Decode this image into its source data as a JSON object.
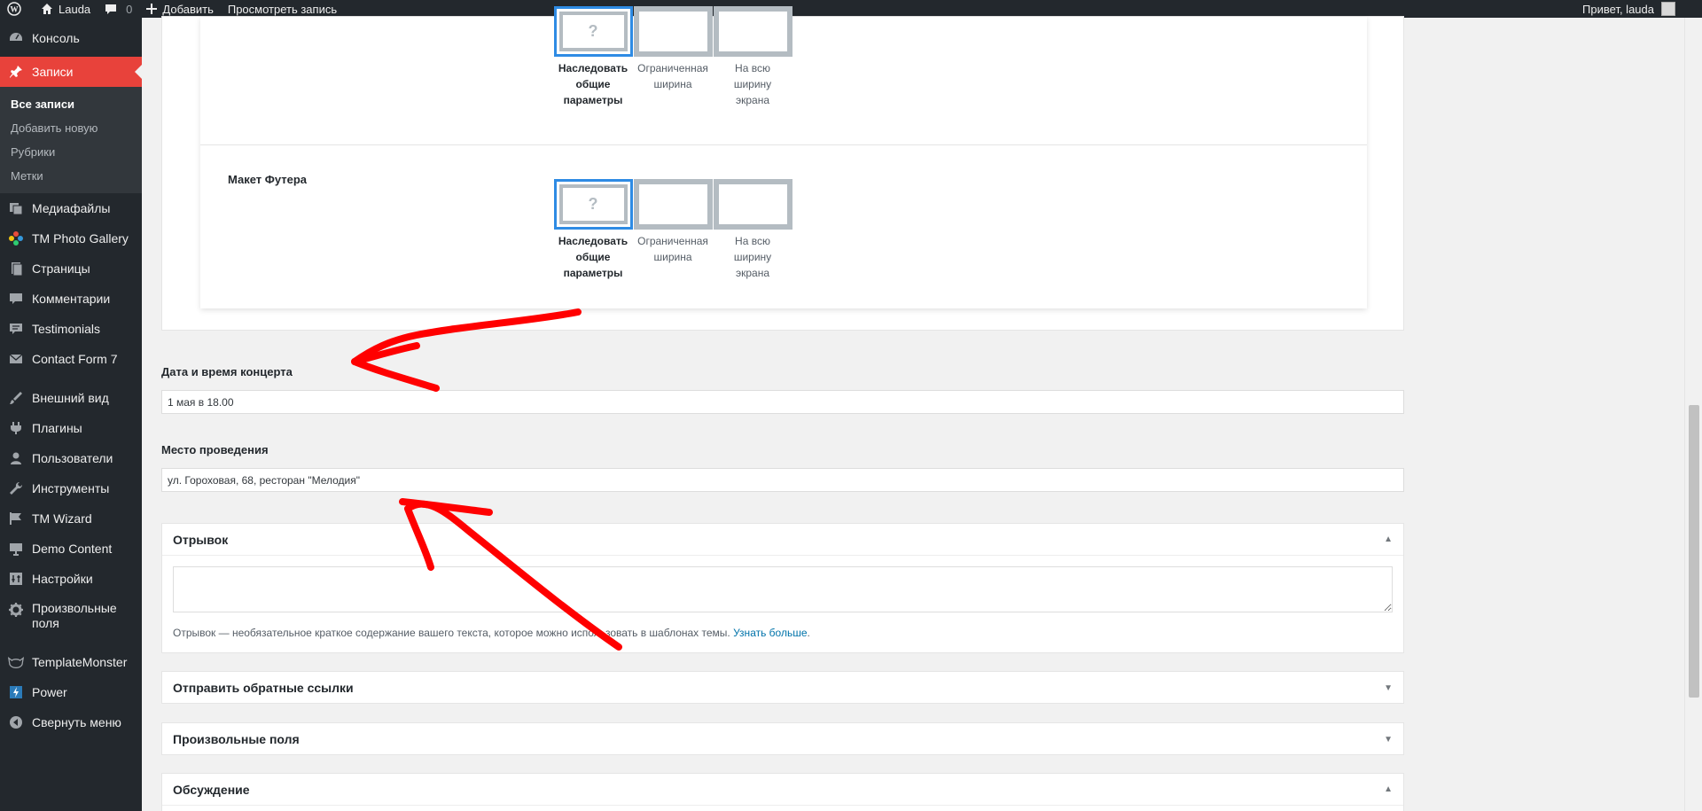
{
  "admin_bar": {
    "site_name": "Lauda",
    "comments_count": "0",
    "add_label": "Добавить",
    "view_label": "Просмотреть запись",
    "greeting": "Привет, lauda"
  },
  "sidebar": {
    "items": [
      {
        "label": "Консоль",
        "icon": "dashboard-icon"
      },
      {
        "label": "Записи",
        "icon": "pin-icon"
      },
      {
        "label": "Медиафайлы",
        "icon": "media-icon"
      },
      {
        "label": "TM Photo Gallery",
        "icon": "gallery-icon"
      },
      {
        "label": "Страницы",
        "icon": "pages-icon"
      },
      {
        "label": "Комментарии",
        "icon": "comments-icon"
      },
      {
        "label": "Testimonials",
        "icon": "testimonials-icon"
      },
      {
        "label": "Contact Form 7",
        "icon": "mail-icon"
      },
      {
        "label": "Внешний вид",
        "icon": "appearance-icon"
      },
      {
        "label": "Плагины",
        "icon": "plugins-icon"
      },
      {
        "label": "Пользователи",
        "icon": "users-icon"
      },
      {
        "label": "Инструменты",
        "icon": "tools-icon"
      },
      {
        "label": "TM Wizard",
        "icon": "flag-icon"
      },
      {
        "label": "Demo Content",
        "icon": "demo-icon"
      },
      {
        "label": "Настройки",
        "icon": "settings-icon"
      },
      {
        "label": "Произвольные поля",
        "icon": "gear-icon"
      },
      {
        "label": "TemplateMonster",
        "icon": "templatemonster-icon"
      },
      {
        "label": "Power",
        "icon": "power-icon"
      },
      {
        "label": "Свернуть меню",
        "icon": "collapse-icon"
      }
    ],
    "submenu": [
      "Все записи",
      "Добавить новую",
      "Рубрики",
      "Метки"
    ]
  },
  "layout_options": {
    "inherit": [
      "Наследовать",
      "общие",
      "параметры"
    ],
    "boxed": [
      "Ограниченная",
      "ширина"
    ],
    "full": [
      "На всю",
      "ширину",
      "экрана"
    ],
    "question_mark": "?"
  },
  "footer_layout_label": "Макет Футера",
  "fields": {
    "concert_label": "Дата и время концерта",
    "concert_value": "1 мая в 18.00",
    "venue_label": "Место проведения",
    "venue_value": "ул. Гороховая, 68, ресторан \"Мелодия\""
  },
  "postboxes": {
    "excerpt_title": "Отрывок",
    "excerpt_help": "Отрывок — необязательное краткое содержание вашего текста, которое можно использовать в шаблонах темы.",
    "excerpt_link": "Узнать больше",
    "trackbacks_title": "Отправить обратные ссылки",
    "custom_fields_title": "Произвольные поля",
    "discussion_title": "Обсуждение",
    "toggle_up": "▲",
    "toggle_down": "▼"
  },
  "colors": {
    "admin_bg": "#23282d",
    "active_menu": "#e8423b",
    "selected_border": "#2e8be4",
    "link": "#0073aa",
    "annotation_arrow": "#ff0000"
  }
}
